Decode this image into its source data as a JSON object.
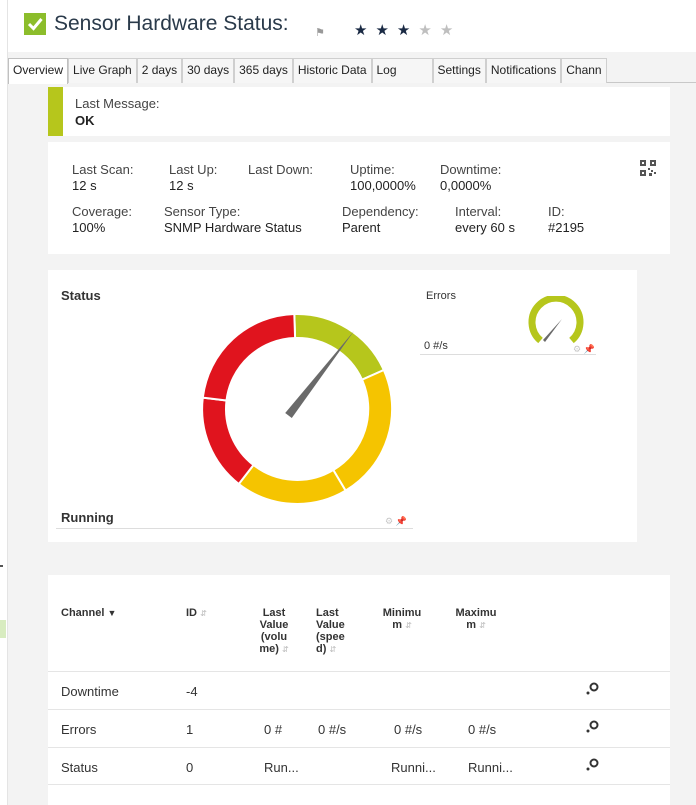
{
  "header": {
    "title": "Sensor Hardware Status:",
    "priority_stars": 3,
    "priority_max": 5,
    "star_glyph": "★"
  },
  "tabs": [
    {
      "label": "Overview",
      "active": true
    },
    {
      "label": "Live Graph"
    },
    {
      "label": "2 days"
    },
    {
      "label": "30 days"
    },
    {
      "label": "365 days"
    },
    {
      "label": "Historic Data"
    },
    {
      "label": "Log"
    },
    {
      "label": "Settings"
    },
    {
      "label": "Notifications"
    },
    {
      "label": "Chann"
    }
  ],
  "last_message": {
    "label": "Last Message:",
    "value": "OK",
    "status_color": "#b6c61c"
  },
  "info": {
    "last_scan": {
      "label": "Last Scan:",
      "value": "12 s"
    },
    "last_up": {
      "label": "Last Up:",
      "value": "12 s"
    },
    "last_down": {
      "label": "Last Down:",
      "value": ""
    },
    "uptime": {
      "label": "Uptime:",
      "value": "100,0000%"
    },
    "downtime": {
      "label": "Downtime:",
      "value": "0,0000%"
    },
    "coverage": {
      "label": "Coverage:",
      "value": "100%"
    },
    "sensor_type": {
      "label": "Sensor Type:",
      "value": "SNMP Hardware Status"
    },
    "dependency": {
      "label": "Dependency:",
      "value": "Parent"
    },
    "interval": {
      "label": "Interval:",
      "value": "every  60 s"
    },
    "id": {
      "label": "ID:",
      "value": "#2195"
    }
  },
  "gauges": {
    "status": {
      "title": "Status",
      "value_label": "Running"
    },
    "errors": {
      "title": "Errors",
      "value_label": "0 #/s"
    }
  },
  "colors": {
    "ok": "#b6c61c",
    "warning": "#f5c400",
    "error": "#e0141e",
    "brand_green": "#8cbd2b"
  },
  "channels": {
    "headers": {
      "channel": "Channel",
      "id": "ID",
      "last_volume": [
        "Last",
        "Value",
        "(volu",
        "me)"
      ],
      "last_speed": [
        "Last",
        "Value",
        "(spee",
        "d)"
      ],
      "minimum": [
        "Minimu",
        "m"
      ],
      "maximum": [
        "Maximu",
        "m"
      ]
    },
    "rows": [
      {
        "channel": "Downtime",
        "id": "-4",
        "last_volume": "",
        "last_speed": "",
        "minimum": "",
        "maximum": ""
      },
      {
        "channel": "Errors",
        "id": "1",
        "last_volume": "0 #",
        "last_speed": "0 #/s",
        "minimum": "0 #/s",
        "maximum": "0 #/s"
      },
      {
        "channel": "Status",
        "id": "0",
        "last_volume": "Run...",
        "last_speed": "",
        "minimum": "Runni...",
        "maximum": "Runni..."
      }
    ]
  }
}
